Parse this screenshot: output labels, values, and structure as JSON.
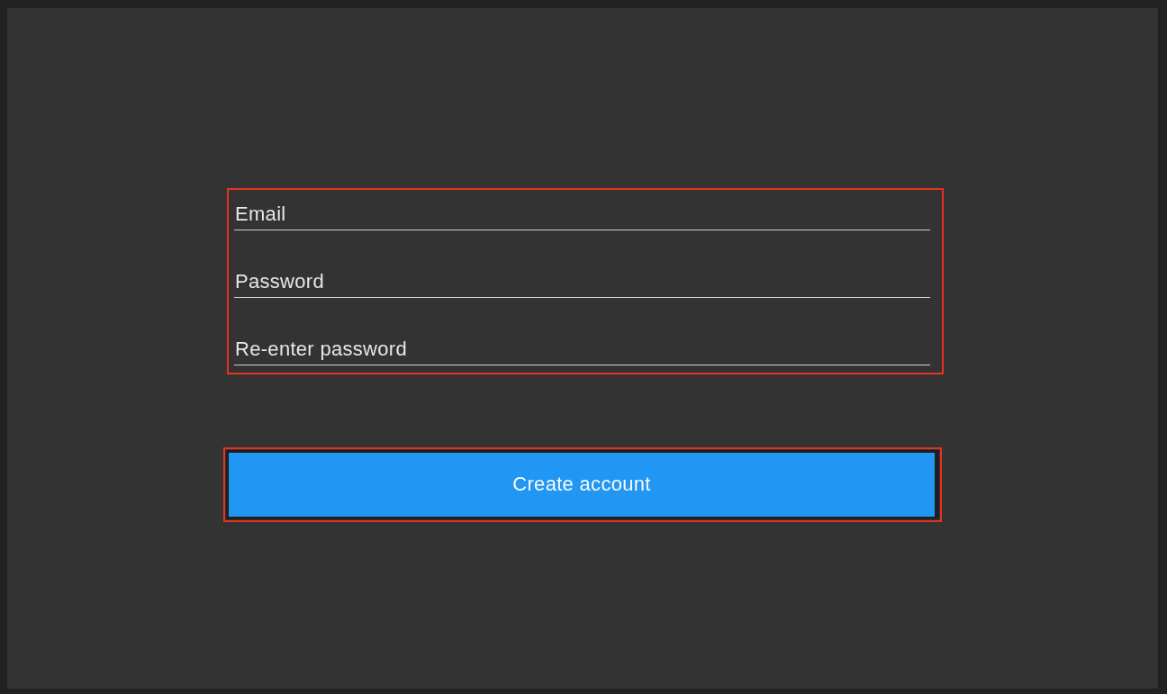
{
  "screen": {
    "form": {
      "highlighted": true,
      "fields": [
        {
          "placeholder": "Email"
        },
        {
          "placeholder": "Password"
        },
        {
          "placeholder": "Re-enter password"
        }
      ]
    },
    "create_button": {
      "label": "Create account",
      "highlighted": true
    }
  }
}
